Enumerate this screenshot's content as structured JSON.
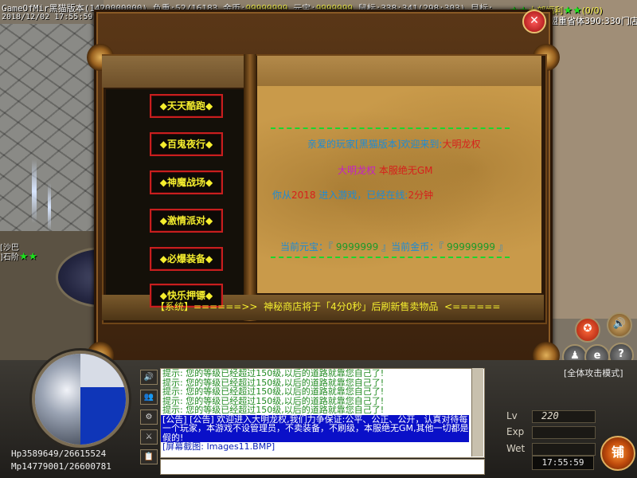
{
  "hud": {
    "top_prefix": "GameOfMir",
    "top_version": "黑猫版本",
    "top_id": "(1420000000)",
    "weight_label": "负重:",
    "weight_value": "52/16183",
    "gold_label": "金币:",
    "gold_value": "99999999",
    "yuanbao_label": "元宝:",
    "yuanbao_value": "9999999",
    "mouse_label": "鼠标:",
    "mouse_value": "338:341(298:303)",
    "target_label": "目标:",
    "datetime": "2018/12/02 17:55:59",
    "right_label": "盟重省体390:330门店",
    "right_title_tail": "大部福利",
    "right_title_count": "(0/0)",
    "star_glyph": "★★",
    "left_player_label1": "[沙巴",
    "left_player_label2": "]石阶",
    "left_player_star": "★★"
  },
  "dialog": {
    "close_glyph": "✕",
    "menu": [
      "◆天天酷跑◆",
      "◆百鬼夜行◆",
      "◆神魔战场◆",
      "◆激情派对◆",
      "◆必爆装备◆",
      "◆快乐押镖◆"
    ],
    "welcome_prefix": "亲爱的玩家",
    "welcome_version": "[黑猫版本]",
    "welcome_mid": "欢迎来到:",
    "welcome_server": "大明龙权",
    "server_name": "大明龙权",
    "server_desc": "本服绝无GM",
    "played_prefix": "你从",
    "played_year": "2018",
    "played_mid": "进入游戏，已经在线:",
    "played_time": "2分钟",
    "yb_label": "当前元宝：『",
    "yb_value": "9999999",
    "yb_mid": "』当前金币：『",
    "gold_value": "99999999",
    "gold_end": "』",
    "sys_prefix": "【系统】======>>",
    "sys_msg": "神秘商店将于「4分0秒」后刷新售卖物品",
    "sys_end": "<======"
  },
  "status": {
    "hp_label": "Hp",
    "hp_value": "3589649/26615524",
    "mp_label": "Mp",
    "mp_value": "14779001/26600781",
    "lv_label": "Lv",
    "lv_value": "220",
    "exp_label": "Exp",
    "wet_label": "Wet",
    "clock": "17:55:59",
    "attack_mode": "[全体攻击模式]",
    "shop_label": "铺"
  },
  "chat": {
    "lines": [
      "提示: 您的等级已经超过150级,以后的道路就靠您自己了!",
      "提示: 您的等级已经超过150级,以后的道路就靠您自己了!",
      "提示: 您的等级已经超过150级,以后的道路就靠您自己了!",
      "提示: 您的等级已经超过150级,以后的道路就靠您自己了!",
      "提示: 您的等级已经超过150级,以后的道路就靠您自己了!"
    ],
    "notice": "[公告] [公告] 欢迎进入大明龙权,我们力争保证:公平、公正、公开，认真对待每一个玩家，本游戏不设管理员，不卖装备，不刷级，本服绝无GM,其他一切都是假的!",
    "screenshot": "[屏幕截图: Images11.BMP]"
  },
  "icons": {
    "side_buttons": [
      "🔊",
      "👥",
      "⚙",
      "⚔",
      "📋",
      "✉"
    ],
    "round_buttons": [
      "✪",
      "🔊",
      "♟",
      "e",
      "?"
    ]
  }
}
